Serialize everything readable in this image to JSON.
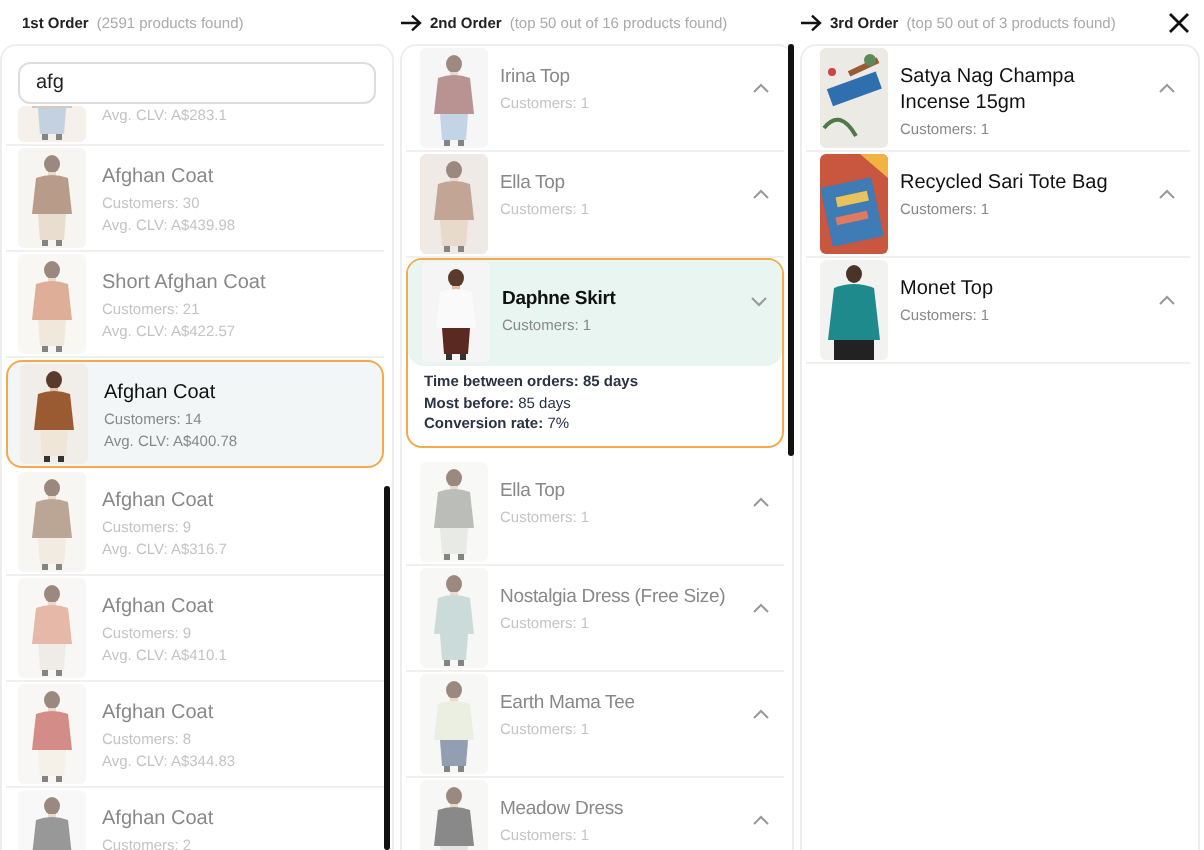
{
  "columns": [
    {
      "title": "1st Order",
      "subtitle": "(2591 products found)",
      "search": {
        "value": "afg"
      },
      "items": [
        {
          "avg_clv": "Avg. CLV: A$283.1",
          "selected": false
        },
        {
          "name": "Afghan Coat",
          "customers": "Customers: 30",
          "avg_clv": "Avg. CLV: A$439.98",
          "selected": false
        },
        {
          "name": "Short Afghan Coat",
          "customers": "Customers: 21",
          "avg_clv": "Avg. CLV: A$422.57",
          "selected": false
        },
        {
          "name": "Afghan Coat",
          "customers": "Customers: 14",
          "avg_clv": "Avg. CLV: A$400.78",
          "selected": true
        },
        {
          "name": "Afghan Coat",
          "customers": "Customers: 9",
          "avg_clv": "Avg. CLV: A$316.7",
          "selected": false
        },
        {
          "name": "Afghan Coat",
          "customers": "Customers: 9",
          "avg_clv": "Avg. CLV: A$410.1",
          "selected": false
        },
        {
          "name": "Afghan Coat",
          "customers": "Customers: 8",
          "avg_clv": "Avg. CLV: A$344.83",
          "selected": false
        },
        {
          "name": "Afghan Coat",
          "customers": "Customers: 2",
          "selected": false
        }
      ]
    },
    {
      "title": "2nd Order",
      "subtitle": "(top 50 out of 16 products found)",
      "items": [
        {
          "name": "Irina Top",
          "customers": "Customers: 1",
          "selected": false,
          "expanded": false
        },
        {
          "name": "Ella Top",
          "customers": "Customers: 1",
          "selected": false,
          "expanded": false
        },
        {
          "name": "Daphne Skirt",
          "customers": "Customers: 1",
          "selected": true,
          "expanded": true,
          "details": [
            {
              "label": "Time between orders:",
              "value": "85 days",
              "strong": true
            },
            {
              "label": "Most before:",
              "value": "85 days",
              "strong": false
            },
            {
              "label": "Conversion rate:",
              "value": "7%",
              "strong": false
            }
          ]
        },
        {
          "name": "Ella Top",
          "customers": "Customers: 1",
          "selected": false,
          "expanded": false
        },
        {
          "name": "Nostalgia Dress (Free Size)",
          "customers": "Customers: 1",
          "selected": false,
          "expanded": false
        },
        {
          "name": "Earth Mama Tee",
          "customers": "Customers: 1",
          "selected": false,
          "expanded": false
        },
        {
          "name": "Meadow Dress",
          "customers": "Customers: 1",
          "selected": false,
          "expanded": false
        }
      ]
    },
    {
      "title": "3rd Order",
      "subtitle": "(top 50 out of 3 products found)",
      "items": [
        {
          "name": "Satya Nag Champa Incense 15gm",
          "customers": "Customers: 1",
          "selected": false,
          "expanded": false
        },
        {
          "name": "Recycled Sari Tote Bag",
          "customers": "Customers: 1",
          "selected": false,
          "expanded": false
        },
        {
          "name": "Monet Top",
          "customers": "Customers: 1",
          "selected": false,
          "expanded": false
        }
      ]
    }
  ]
}
